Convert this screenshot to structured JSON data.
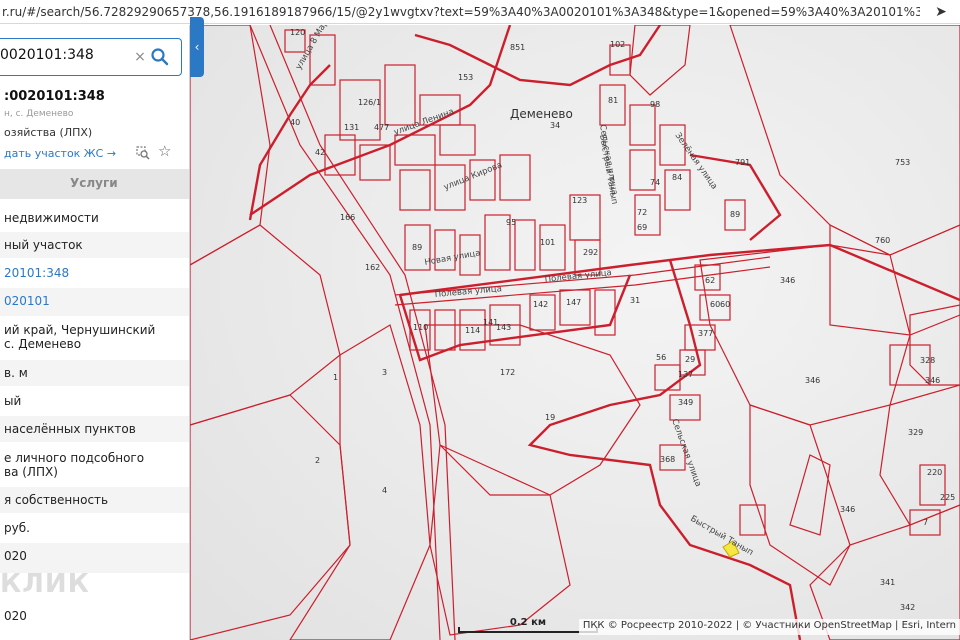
{
  "browser": {
    "url": "r.ru/#/search/56.72829290657378,56.1916189187966/15/@2y1wvgtxv?text=59%3A40%3A0020101%3A348&type=1&opened=59%3A40%3A20101%3A348"
  },
  "search": {
    "value": "0020101:348"
  },
  "object": {
    "title": ":0020101:348",
    "address": "н, с. Деменево",
    "purpose": "озяйства (ЛПХ)",
    "order_link": "дать участок ЖС →"
  },
  "tabs": {
    "services": "Услуги"
  },
  "details": [
    {
      "text": " недвижимости",
      "style": "plain"
    },
    {
      "text": "ный участок",
      "style": "alt"
    },
    {
      "text": "20101:348",
      "style": "link"
    },
    {
      "text": "020101",
      "style": "link-alt"
    },
    {
      "text": "ий край, Чернушинский\nс. Деменево",
      "style": "plain"
    },
    {
      "text": "в. м",
      "style": "alt"
    },
    {
      "text": "ый",
      "style": "plain"
    },
    {
      "text": "населённых пунктов",
      "style": "alt"
    },
    {
      "text": "е личного подсобного\nва (ЛПХ)",
      "style": "plain"
    },
    {
      "text": "я собственность",
      "style": "alt"
    },
    {
      "text": "руб.",
      "style": "plain"
    },
    {
      "text": "020",
      "style": "alt"
    },
    {
      "text": "020",
      "style": "plain"
    }
  ],
  "watermark": "КЛИК",
  "map": {
    "town": "Деменево",
    "streets": [
      "улица 8 Марта",
      "улица Ленина",
      "улица Кирова",
      "Новая улица",
      "Полевая улица",
      "Полевая улица",
      "Сельская улица",
      "Зелёная улица",
      "Быстрый Танып",
      "Сельская улица",
      "Быстрый Танып"
    ],
    "parcels": [
      "120",
      "851",
      "153",
      "102",
      "40",
      "126/1",
      "477",
      "131",
      "34",
      "98",
      "81",
      "42",
      "791",
      "753",
      "166",
      "123",
      "89",
      "760",
      "60",
      "162",
      "89",
      "95",
      "101",
      "292",
      "72",
      "69",
      "62",
      "346",
      "110",
      "114",
      "141",
      "143",
      "142",
      "147",
      "31",
      "60",
      "377",
      "328",
      "1",
      "3",
      "172",
      "56",
      "29",
      "137",
      "346",
      "19",
      "349",
      "329",
      "2",
      "368",
      "4",
      "220",
      "225",
      "7",
      "341",
      "342",
      "346",
      "74",
      "84",
      "346"
    ],
    "scale_label": "0.2 км",
    "attribution": "ПКК © Росреестр 2010-2022 | © Участники OpenStreetMap | Esri, Intern"
  },
  "colors": {
    "parcel_border": "#cc1f2d",
    "accent": "#2b78c5",
    "selected_parcel": "#f5e642"
  }
}
